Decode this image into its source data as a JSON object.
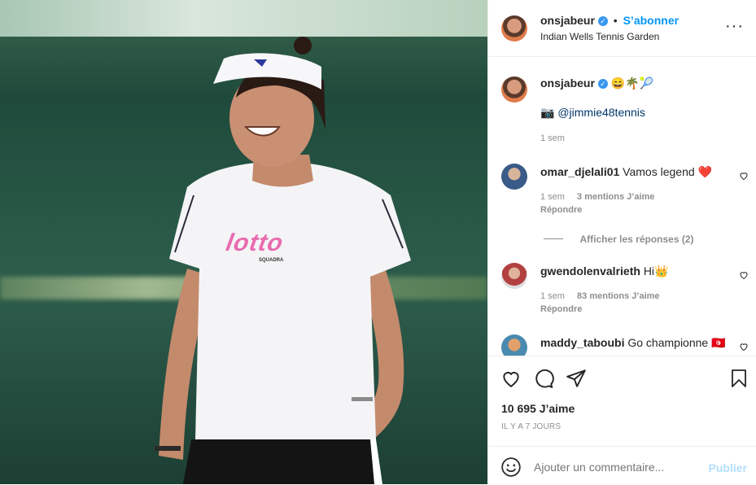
{
  "header": {
    "username": "onsjabeur",
    "separator": "•",
    "follow_label": "S’abonner",
    "location": "Indian Wells Tennis Garden",
    "more_icon": "more-horizontal-icon"
  },
  "caption": {
    "username": "onsjabeur",
    "emojis": "😄🌴🎾",
    "credit_icon": "📷",
    "credit": "@jimmie48tennis",
    "time": "1 sem"
  },
  "comments": [
    {
      "username": "omar_djelali01",
      "text": "Vamos legend ❤️",
      "time": "1 sem",
      "likes": "3 mentions J’aime",
      "reply": "Répondre",
      "view_replies": "Afficher les réponses (2)"
    },
    {
      "username": "gwendolenvalrieth",
      "text": "Hi👑",
      "time": "1 sem",
      "likes": "83 mentions J’aime",
      "reply": "Répondre"
    },
    {
      "username": "maddy_taboubi",
      "text": "Go championne 🇹🇳"
    }
  ],
  "actions": {
    "likes": "10 695 J’aime",
    "posted": "IL Y A 7 JOURS"
  },
  "comment_box": {
    "placeholder": "Ajouter un commentaire...",
    "publish": "Publier"
  },
  "photo": {
    "shirt_brand": "lotto",
    "shirt_sub": "SQUADRA"
  }
}
